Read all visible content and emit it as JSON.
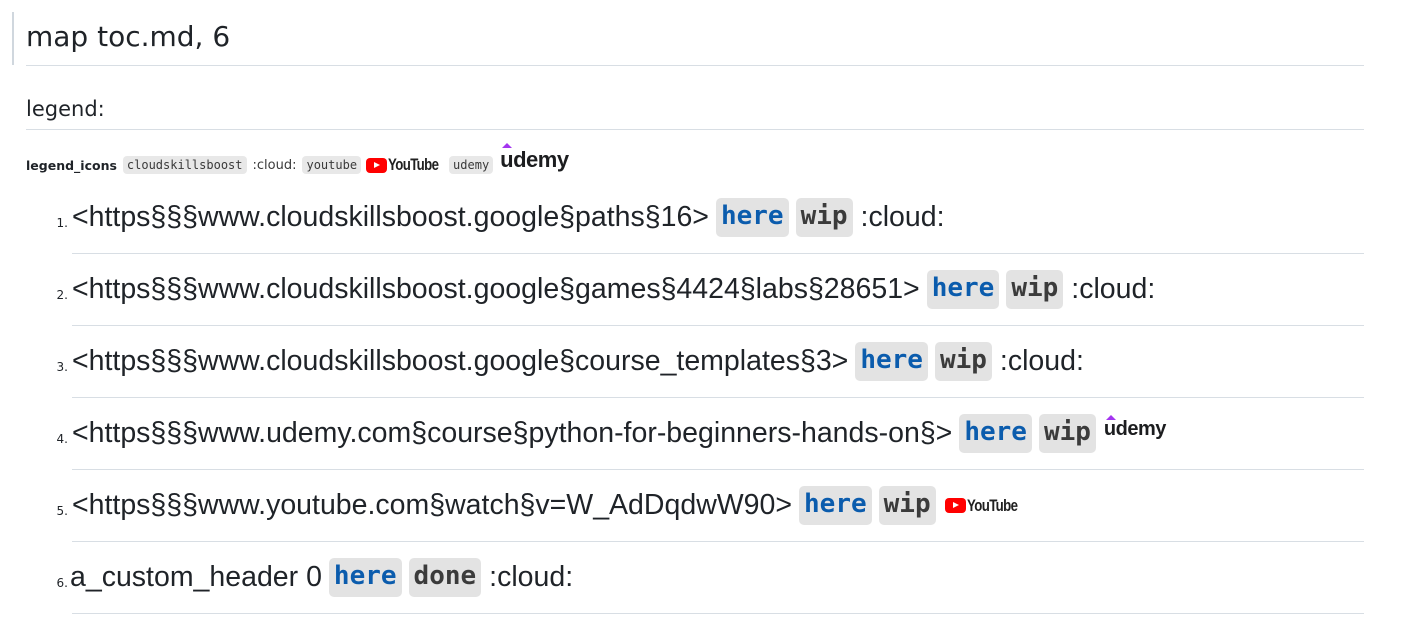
{
  "title": "map toc.md, 6",
  "legend_heading": "legend:",
  "legend": {
    "label": "legend_icons",
    "chip_cloud": "cloudskillsboost",
    "cloud_text": ":cloud:",
    "chip_youtube": "youtube",
    "chip_udemy": "udemy",
    "youtube_logo_text": "YouTube",
    "udemy_logo_text": "udemy"
  },
  "items": [
    {
      "number": "1.",
      "text": "<https§§§www.cloudskillsboost.google§paths§16>",
      "link": "here",
      "status": "wip",
      "icon": "cloud",
      "tail": ":cloud:"
    },
    {
      "number": "2.",
      "text": "<https§§§www.cloudskillsboost.google§games§4424§labs§28651>",
      "link": "here",
      "status": "wip",
      "icon": "cloud",
      "tail": ":cloud:"
    },
    {
      "number": "3.",
      "text": "<https§§§www.cloudskillsboost.google§course_templates§3>",
      "link": "here",
      "status": "wip",
      "icon": "cloud",
      "tail": ":cloud:"
    },
    {
      "number": "4.",
      "text": "<https§§§www.udemy.com§course§python-for-beginners-hands-on§>",
      "link": "here",
      "status": "wip",
      "icon": "udemy-logo",
      "tail": "udemy"
    },
    {
      "number": "5.",
      "text": "<https§§§www.youtube.com§watch§v=W_AdDqdwW90>",
      "link": "here",
      "status": "wip",
      "icon": "youtube-logo",
      "tail": "YouTube"
    },
    {
      "number": "6.",
      "text": "a_custom_header 0",
      "link": "here",
      "status": "done",
      "icon": "cloud",
      "tail": ":cloud:"
    }
  ],
  "colors": {
    "link": "#0b5cad",
    "code_bg": "#e3e3e3",
    "rule": "#d8dee4",
    "youtube_red": "#ff0000",
    "udemy_purple": "#a435f0"
  }
}
